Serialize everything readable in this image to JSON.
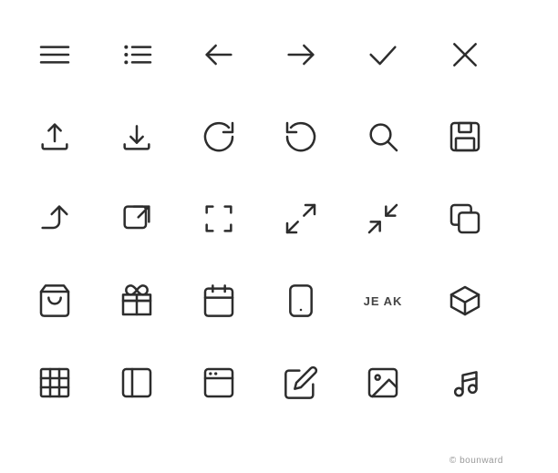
{
  "icons": [
    {
      "id": "hamburger-menu",
      "row": 1,
      "col": 1
    },
    {
      "id": "list-menu",
      "row": 1,
      "col": 2
    },
    {
      "id": "arrow-left",
      "row": 1,
      "col": 3
    },
    {
      "id": "arrow-right",
      "row": 1,
      "col": 4
    },
    {
      "id": "checkmark",
      "row": 1,
      "col": 5
    },
    {
      "id": "close",
      "row": 1,
      "col": 6
    },
    {
      "id": "upload",
      "row": 2,
      "col": 1
    },
    {
      "id": "download",
      "row": 2,
      "col": 2
    },
    {
      "id": "refresh-cw",
      "row": 2,
      "col": 3
    },
    {
      "id": "refresh-ccw",
      "row": 2,
      "col": 4
    },
    {
      "id": "search",
      "row": 2,
      "col": 5
    },
    {
      "id": "save",
      "row": 2,
      "col": 6
    },
    {
      "id": "share-forward",
      "row": 3,
      "col": 1
    },
    {
      "id": "external-link",
      "row": 3,
      "col": 2
    },
    {
      "id": "frame",
      "row": 3,
      "col": 3
    },
    {
      "id": "expand",
      "row": 3,
      "col": 4
    },
    {
      "id": "compress",
      "row": 3,
      "col": 5
    },
    {
      "id": "copy",
      "row": 3,
      "col": 6
    },
    {
      "id": "shopping-bag",
      "row": 4,
      "col": 1
    },
    {
      "id": "gift",
      "row": 4,
      "col": 2
    },
    {
      "id": "calendar",
      "row": 4,
      "col": 3
    },
    {
      "id": "phone-rounded",
      "row": 4,
      "col": 4
    },
    {
      "id": "cube-3d",
      "row": 4,
      "col": 6
    },
    {
      "id": "table",
      "row": 5,
      "col": 1
    },
    {
      "id": "sidebar-panel",
      "row": 5,
      "col": 2
    },
    {
      "id": "browser-window",
      "row": 5,
      "col": 3
    },
    {
      "id": "edit-pencil",
      "row": 5,
      "col": 4
    },
    {
      "id": "image",
      "row": 5,
      "col": 5
    },
    {
      "id": "music-note",
      "row": 5,
      "col": 6
    }
  ],
  "watermark": "© bounward",
  "overlay_text": "JE AK"
}
